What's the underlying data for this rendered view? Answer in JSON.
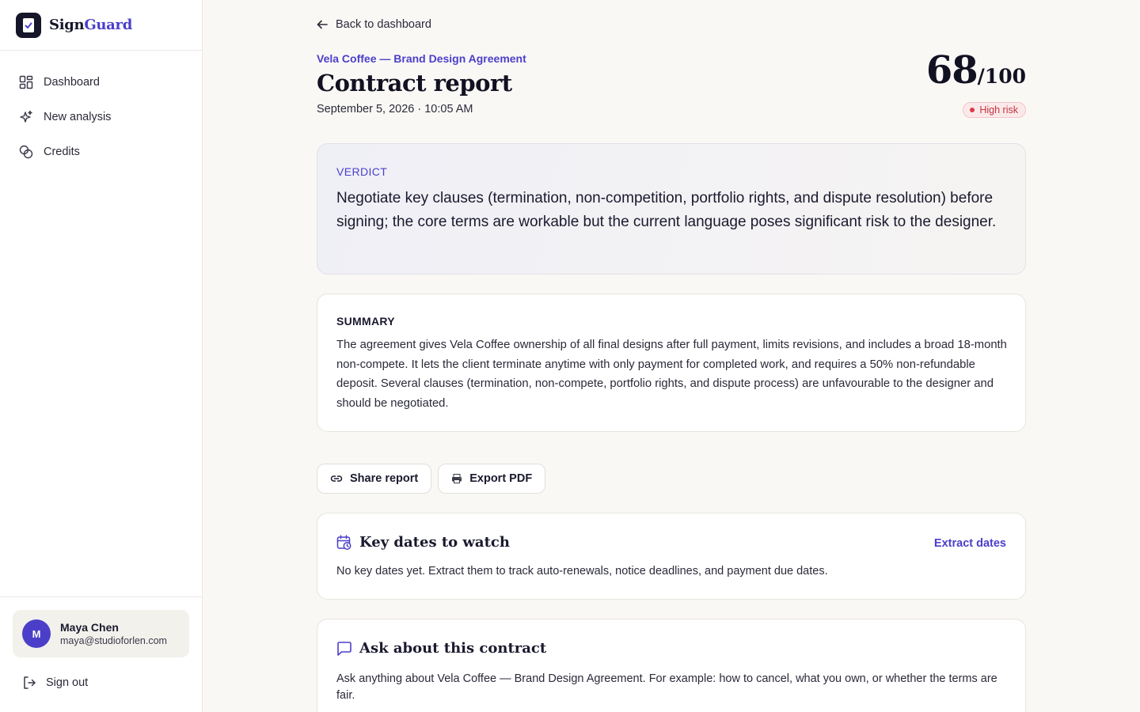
{
  "brand": {
    "name_part1": "Sign",
    "name_part2": "Guard"
  },
  "sidebar": {
    "items": [
      {
        "label": "Dashboard",
        "icon": "dashboard-grid-icon"
      },
      {
        "label": "New analysis",
        "icon": "sparkles-icon"
      },
      {
        "label": "Credits",
        "icon": "coins-icon"
      }
    ]
  },
  "user": {
    "initial": "M",
    "name": "Maya Chen",
    "email": "maya@studioforlen.com"
  },
  "signout": {
    "label": "Sign out"
  },
  "back": {
    "label": "Back to dashboard"
  },
  "report": {
    "contract_name": "Vela Coffee — Brand Design Agreement",
    "title": "Contract report",
    "timestamp": "September 5, 2026 · 10:05 AM",
    "score": "68",
    "score_max": "/100",
    "risk_label": "High risk"
  },
  "verdict": {
    "label": "VERDICT",
    "text": "Negotiate key clauses (termination, non-competition, portfolio rights, and dispute resolution) before signing; the core terms are workable but the current language poses significant risk to the designer."
  },
  "summary": {
    "label": "SUMMARY",
    "text": "The agreement gives Vela Coffee ownership of all final designs after full payment, limits revisions, and includes a broad 18-month non-compete. It lets the client terminate anytime with only payment for completed work, and requires a 50% non-refundable deposit. Several clauses (termination, non-compete, portfolio rights, and dispute process) are unfavourable to the designer and should be negotiated."
  },
  "actions": {
    "share_label": "Share report",
    "export_label": "Export PDF"
  },
  "key_dates": {
    "title": "Key dates to watch",
    "action_label": "Extract dates",
    "empty_text": "No key dates yet. Extract them to track auto-renewals, notice deadlines, and payment due dates."
  },
  "ask": {
    "title": "Ask about this contract",
    "text": "Ask anything about Vela Coffee — Brand Design Agreement. For example: how to cancel, what you own, or whether the terms are fair."
  },
  "colors": {
    "accent": "#4b3fc9",
    "risk": "#c4333f",
    "background": "#faf8f5"
  }
}
